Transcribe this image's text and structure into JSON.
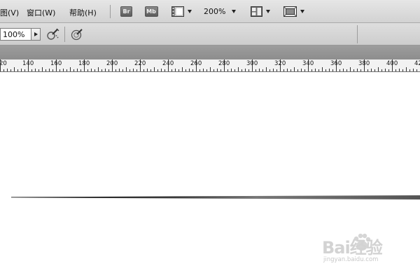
{
  "menubar": {
    "items": [
      "图(V)",
      "窗口(W)",
      "帮助(H)"
    ],
    "bridge_label": "Br",
    "minibridge_label": "Mb",
    "zoom_level": "200%"
  },
  "options": {
    "zoom_value": "100%"
  },
  "ruler": {
    "labels": [
      "20",
      "140",
      "160",
      "180",
      "200",
      "220",
      "240",
      "260",
      "280",
      "300",
      "320",
      "340",
      "360",
      "380",
      "400",
      "42"
    ]
  },
  "watermark": {
    "word": "Bai经验",
    "url": "jingyan.baidu.com"
  },
  "colors": {
    "menubar": "#dadada",
    "band": "#959595",
    "canvas": "#ffffff",
    "stroke": "#2a2a2a"
  }
}
